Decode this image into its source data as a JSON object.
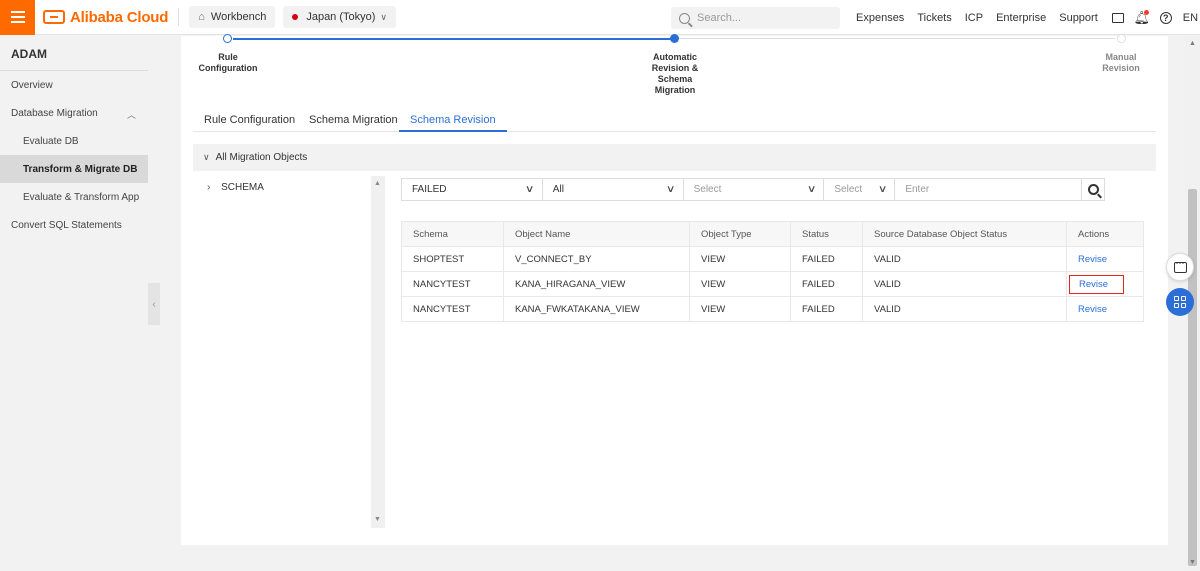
{
  "topbar": {
    "brand": "Alibaba Cloud",
    "workbench": "Workbench",
    "region": "Japan (Tokyo)",
    "search_placeholder": "Search...",
    "links": [
      "Expenses",
      "Tickets",
      "ICP",
      "Enterprise",
      "Support"
    ],
    "language": "EN"
  },
  "sidebar": {
    "title": "ADAM",
    "items": [
      {
        "label": "Overview"
      },
      {
        "label": "Database Migration"
      },
      {
        "label": "Evaluate DB"
      },
      {
        "label": "Transform & Migrate DB"
      },
      {
        "label": "Evaluate & Transform App"
      },
      {
        "label": "Convert SQL Statements"
      }
    ]
  },
  "steps": [
    {
      "label": "Rule Configuration",
      "state": "done"
    },
    {
      "label": "Automatic Revision & Schema Migration",
      "state": "current"
    },
    {
      "label": "Manual Revision",
      "state": "pending"
    }
  ],
  "tabs": [
    "Rule Configuration",
    "Schema Migration",
    "Schema Revision"
  ],
  "active_tab": "Schema Revision",
  "tree": {
    "header": "All Migration Objects",
    "nodes": [
      "SCHEMA"
    ]
  },
  "filters": {
    "status": "FAILED",
    "all": "All",
    "select1": "Select",
    "select2": "Select",
    "input_placeholder": "Enter"
  },
  "table": {
    "columns": [
      "Schema",
      "Object Name",
      "Object Type",
      "Status",
      "Source Database Object Status",
      "Actions"
    ],
    "rows": [
      {
        "schema": "SHOPTEST",
        "name": "V_CONNECT_BY",
        "type": "VIEW",
        "status": "FAILED",
        "source_status": "VALID",
        "action": "Revise"
      },
      {
        "schema": "NANCYTEST",
        "name": "KANA_HIRAGANA_VIEW",
        "type": "VIEW",
        "status": "FAILED",
        "source_status": "VALID",
        "action": "Revise"
      },
      {
        "schema": "NANCYTEST",
        "name": "KANA_FWKATAKANA_VIEW",
        "type": "VIEW",
        "status": "FAILED",
        "source_status": "VALID",
        "action": "Revise"
      }
    ]
  },
  "colors": {
    "brand": "#ff6a00",
    "accent": "#2b6fd6",
    "highlight": "#e0271b"
  }
}
